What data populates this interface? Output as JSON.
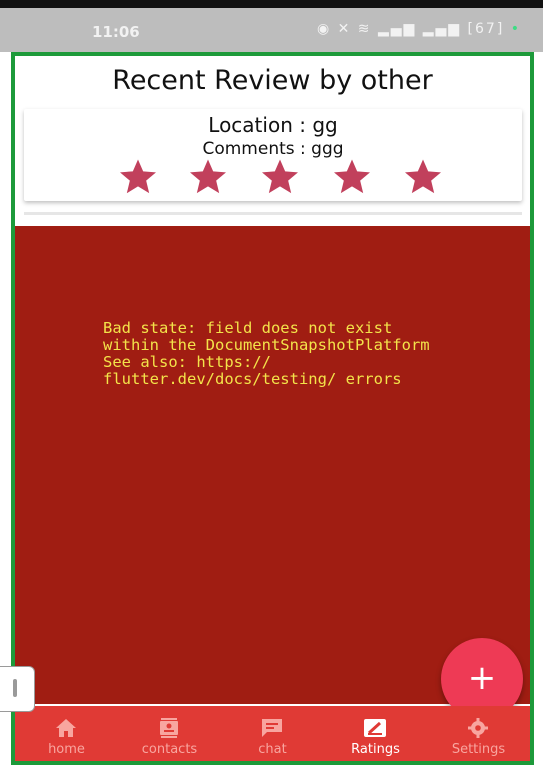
{
  "status_bar": {
    "time": "11:06",
    "battery": "67"
  },
  "header": {
    "title": "Recent Review by other"
  },
  "review": {
    "location": "Location : gg",
    "comments": "Comments : ggg",
    "rating": 5,
    "star_color": "#c1405c"
  },
  "error": {
    "message": "Bad state: field does not exist within the DocumentSnapshotPlatform\nSee also: https:// flutter.dev/docs/testing/ errors",
    "background": "#a01d12",
    "text_color": "#f3e34a"
  },
  "fab": {
    "icon": "plus-icon",
    "label": "+"
  },
  "bottom_nav": {
    "active_index": 3,
    "items": [
      {
        "label": "home",
        "icon": "home-icon"
      },
      {
        "label": "contacts",
        "icon": "contacts-icon"
      },
      {
        "label": "chat",
        "icon": "chat-icon"
      },
      {
        "label": "Ratings",
        "icon": "ratings-icon"
      },
      {
        "label": "Settings",
        "icon": "settings-icon"
      }
    ]
  },
  "colors": {
    "frame_border": "#1d9a3a",
    "nav_bg": "#e03a35",
    "fab_bg": "#ee3a55"
  }
}
